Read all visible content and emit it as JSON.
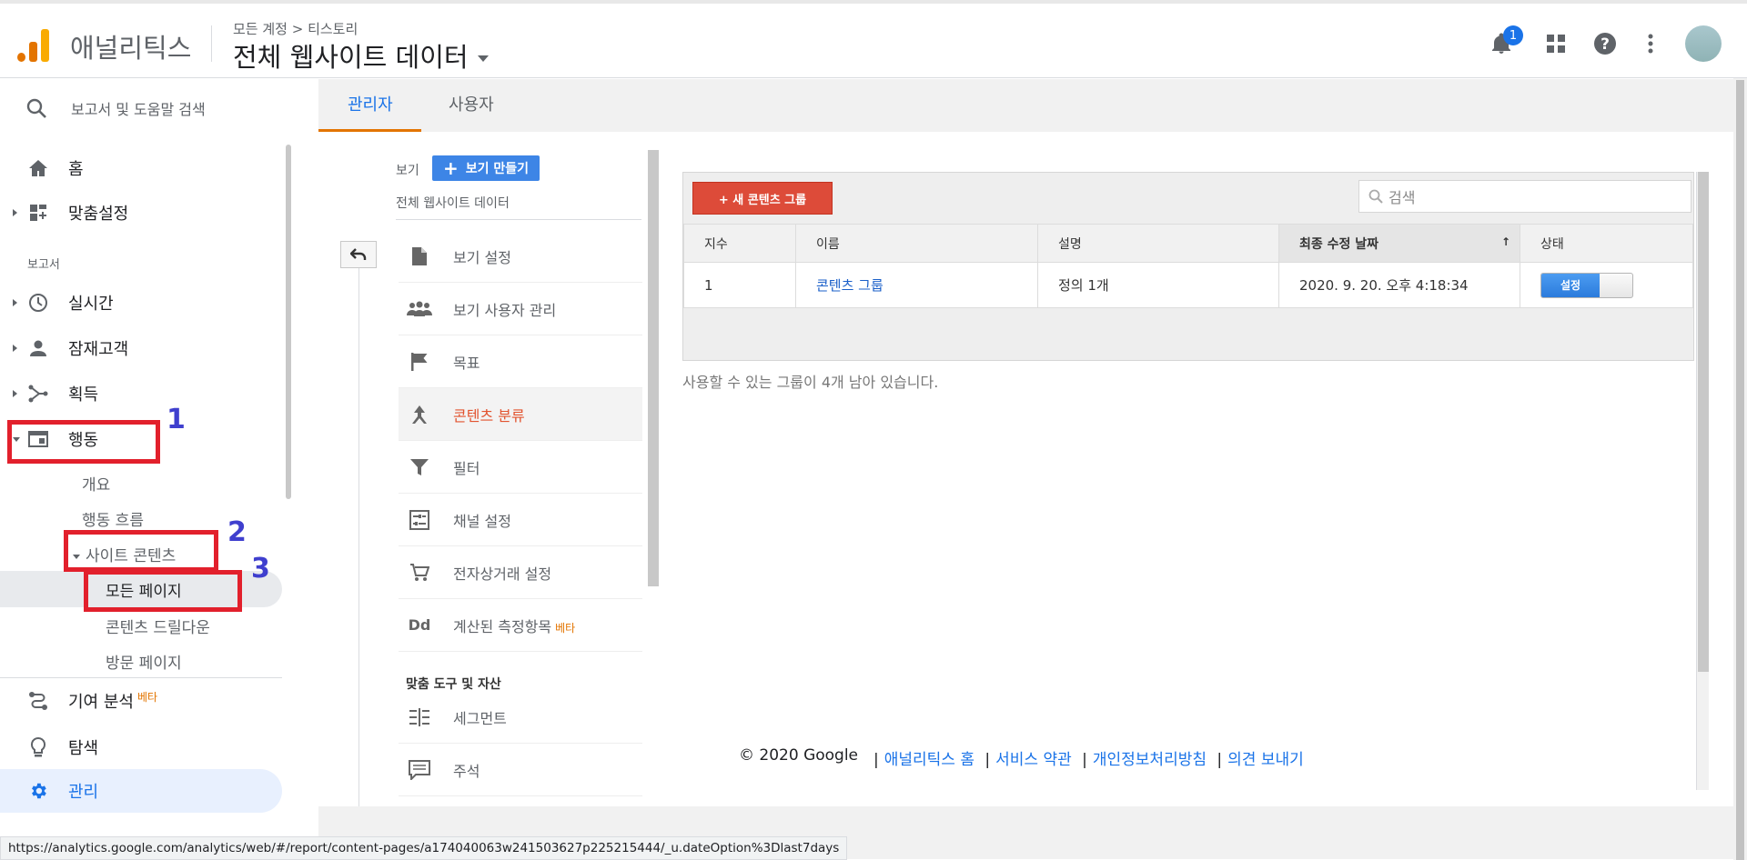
{
  "header": {
    "app_name": "애널리틱스",
    "breadcrumb": "모든 계정 > 티스토리",
    "property_title": "전체 웹사이트 데이터",
    "notification_count": "1"
  },
  "sidebar": {
    "search_placeholder": "보고서 및 도움말 검색",
    "items": {
      "home": "홈",
      "customization": "맞춤설정",
      "reports_section": "보고서",
      "realtime": "실시간",
      "audience": "잠재고객",
      "acquisition": "획득",
      "behavior": "행동",
      "overview": "개요",
      "behavior_flow": "행동 흐름",
      "site_content": "사이트 콘텐츠",
      "all_pages": "모든 페이지",
      "content_drilldown": "콘텐츠 드릴다운",
      "landing_pages": "방문 페이지",
      "attribution": "기여 분석",
      "attribution_beta": "베타",
      "discover": "탐색",
      "admin": "관리"
    }
  },
  "annotations": [
    "1",
    "2",
    "3"
  ],
  "tabs": {
    "admin": "관리자",
    "user": "사용자"
  },
  "view_panel": {
    "view_label": "보기",
    "create_view": "보기 만들기",
    "view_name": "전체 웹사이트 데이터",
    "menu": {
      "view_settings": "보기 설정",
      "view_user_mgmt": "보기 사용자 관리",
      "goals": "목표",
      "content_grouping": "콘텐츠 분류",
      "filters": "필터",
      "channel_settings": "채널 설정",
      "ecommerce_settings": "전자상거래 설정",
      "calculated_metrics": "계산된 측정항목",
      "calculated_beta": "베타",
      "personal_tools_heading": "맞춤 도구 및 자산",
      "segments": "세그먼트",
      "annotations": "주석"
    }
  },
  "content_groups": {
    "new_button": "+ 새 콘텐츠 그룹",
    "search_placeholder": "검색",
    "columns": {
      "index": "지수",
      "name": "이름",
      "description": "설명",
      "modified": "최종 수정 날짜",
      "status": "상태"
    },
    "rows": [
      {
        "index": "1",
        "name": "콘텐츠 그룹",
        "description": "정의 1개",
        "modified": "2020. 9. 20. 오후 4:18:34",
        "status": "설정"
      }
    ],
    "remaining_note": "사용할 수 있는 그룹이 4개 남아 있습니다."
  },
  "footer": {
    "copyright": "© 2020 Google",
    "links": {
      "analytics_home": "애널리틱스 홈",
      "terms": "서비스 약관",
      "privacy": "개인정보처리방침",
      "feedback": "의견 보내기"
    }
  },
  "status_url": "https://analytics.google.com/analytics/web/#/report/content-pages/a174040063w241503627p225215444/_u.dateOption%3Dlast7days"
}
